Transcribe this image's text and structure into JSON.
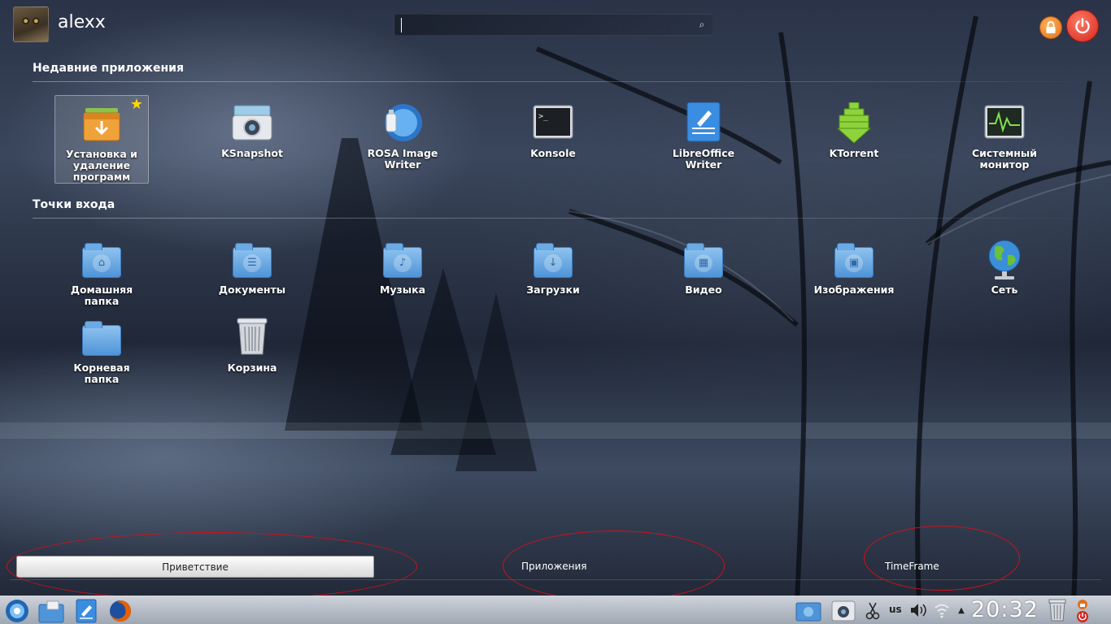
{
  "user": {
    "name": "alexx"
  },
  "search": {
    "value": "",
    "placeholder": ""
  },
  "sections": {
    "recent_title": "Недавние приложения",
    "places_title": "Точки входа"
  },
  "recent_apps": [
    {
      "label": "Установка и удаление программ",
      "icon": "package-manager-icon",
      "favorite": true,
      "selected": true
    },
    {
      "label": "KSnapshot",
      "icon": "camera-icon"
    },
    {
      "label": "ROSA Image Writer",
      "icon": "usb-writer-icon"
    },
    {
      "label": "Konsole",
      "icon": "terminal-icon"
    },
    {
      "label": "LibreOffice Writer",
      "icon": "writer-document-icon"
    },
    {
      "label": "KTorrent",
      "icon": "torrent-icon"
    },
    {
      "label": "Системный монитор",
      "icon": "system-monitor-icon"
    }
  ],
  "places": [
    {
      "label": "Домашняя папка",
      "icon": "home-folder-icon"
    },
    {
      "label": "Документы",
      "icon": "documents-folder-icon"
    },
    {
      "label": "Музыка",
      "icon": "music-folder-icon"
    },
    {
      "label": "Загрузки",
      "icon": "downloads-folder-icon"
    },
    {
      "label": "Видео",
      "icon": "video-folder-icon"
    },
    {
      "label": "Изображения",
      "icon": "pictures-folder-icon"
    },
    {
      "label": "Сеть",
      "icon": "network-globe-icon"
    },
    {
      "label": "Корневая папка",
      "icon": "root-folder-icon"
    },
    {
      "label": "Корзина",
      "icon": "trash-icon"
    }
  ],
  "tabs": [
    {
      "label": "Приветствие",
      "active": true
    },
    {
      "label": "Приложения",
      "active": false
    },
    {
      "label": "TimeFrame",
      "active": false
    }
  ],
  "taskbar": {
    "keyboard_layout": "us",
    "clock": "20:32"
  },
  "colors": {
    "accent_red": "#d0101a",
    "lock_orange": "#e2701c",
    "power_red": "#d3261c",
    "folder_blue": "#4f94d8"
  }
}
